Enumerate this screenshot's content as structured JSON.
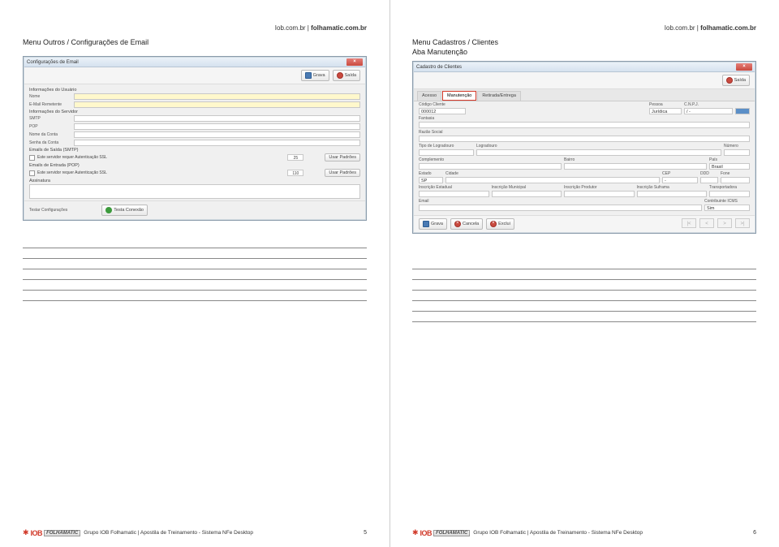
{
  "header_link_plain": "Iob.com.br | ",
  "header_link_bold": "folhamatic.com.br",
  "left": {
    "menu_title": "Menu Outros / Configurações de Email",
    "win_title": "Configurações de Email",
    "btn_grava": "Grava",
    "btn_saida": "Saída",
    "sec_user": "Informações do Usuário",
    "nome": "Nome",
    "email_rem": "E-Mail Remetente",
    "sec_serv": "Informações do Servidor",
    "smtp": "SMTP",
    "pop": "POP",
    "nome_conta": "Nome da Conta",
    "senha_conta": "Senha da Conta",
    "saida_smtp": "Emails de Saída (SMTP)",
    "ssl_check": "Este servidor requer Autenticação SSL",
    "port1": "25",
    "usar_padroes": "Usar Padrões",
    "entrada_pop": "Emails de Entrada (POP)",
    "port2": "110",
    "assinatura": "Assinatura",
    "testar": "Testar Configurações",
    "testa_conexao": "Testa Conexão"
  },
  "right": {
    "menu_title": "Menu Cadastros / Clientes",
    "sub_title": "Aba Manutenção",
    "win_title": "Cadastro de Clientes",
    "btn_saida": "Saída",
    "tab_acesso": "Acesso",
    "tab_manut": "Manutenção",
    "tab_ret": "Retirada/Entrega",
    "cod_cliente": "Código Cliente",
    "cod_val": "000012",
    "pessoa": "Pessoa",
    "pessoa_val": "Jurídica",
    "cnpj": "C.N.P.J.",
    "cnpj_val": "/        -",
    "fantasia": "Fantasia",
    "razao": "Razão Social",
    "tipo_log": "Tipo de Logradouro",
    "logradouro": "Logradouro",
    "numero": "Número",
    "complemento": "Complemento",
    "bairro": "Bairro",
    "pais": "País",
    "pais_val": "Brasil",
    "estado": "Estado",
    "estado_val": "SP",
    "cidade": "Cidade",
    "cep": "CEP",
    "cep_val": "-",
    "ddd": "DDD",
    "fone": "Fone",
    "insc_est": "Inscrição Estadual",
    "insc_mun": "Inscrição Municipal",
    "insc_prod": "Inscrição Produtor",
    "insc_suf": "Inscrição Suframa",
    "transp": "Transportadora",
    "email": "Email",
    "contrib": "Contribuinte ICMS",
    "contrib_val": "Sim",
    "btn_grava": "Grava",
    "btn_cancela": "Cancela",
    "btn_exclui": "Exclui",
    "nav1": "|<",
    "nav2": "<",
    "nav3": ">",
    "nav4": ">|"
  },
  "footer": {
    "text": "Grupo IOB Folhamatic | Apostila de Treinamento - Sistema NFe Desktop",
    "page_left": "5",
    "page_right": "6",
    "folh": "FOLHAMATIC"
  }
}
